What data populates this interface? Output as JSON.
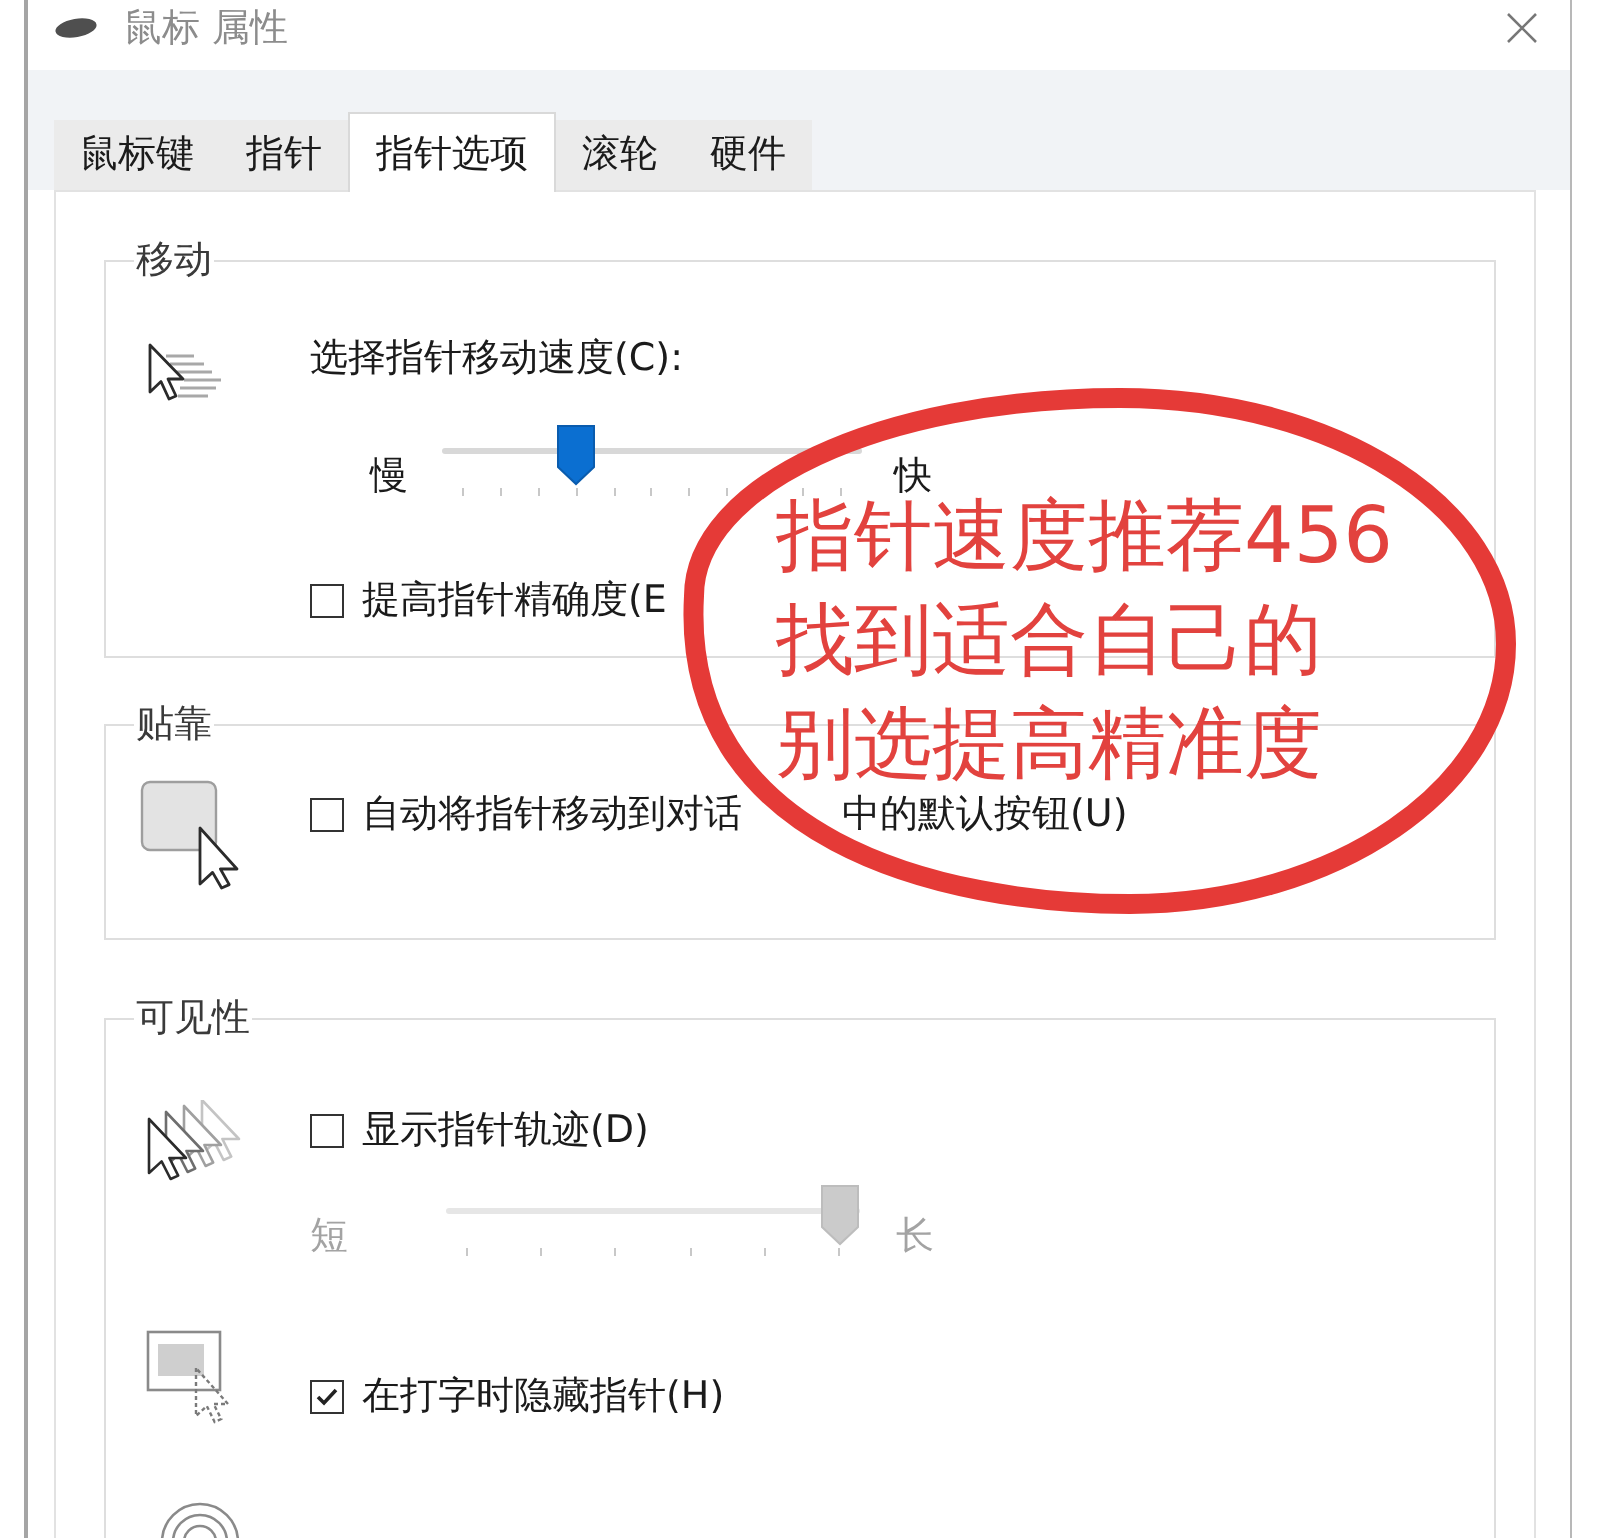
{
  "window": {
    "title": "鼠标 属性"
  },
  "tabs": [
    {
      "label": "鼠标键",
      "selected": false
    },
    {
      "label": "指针",
      "selected": false
    },
    {
      "label": "指针选项",
      "selected": true
    },
    {
      "label": "滚轮",
      "selected": false
    },
    {
      "label": "硬件",
      "selected": false
    }
  ],
  "motion": {
    "title": "移动",
    "speed_label": "选择指针移动速度(C):",
    "speed_slider": {
      "min_label": "慢",
      "max_label": "快",
      "level": 0.3,
      "disabled": false
    },
    "enhance_precision": {
      "label": "提高指针精确度(E",
      "checked": false
    }
  },
  "snap_to": {
    "title": "贴靠",
    "default_button": {
      "label_parts": [
        "自动将指针移动到对话",
        "中的默认按钮(U)"
      ],
      "checked": false
    }
  },
  "visibility": {
    "title": "可见性",
    "pointer_trails": {
      "label": "显示指针轨迹(D)",
      "checked": false
    },
    "trail_slider": {
      "min_label": "短",
      "max_label": "长",
      "level": 1,
      "disabled": true
    },
    "hide_while_typing": {
      "label": "在打字时隐藏指针(H)",
      "checked": true
    }
  },
  "annotation": {
    "lines": [
      "指针速度推荐456",
      "找到适合自己的",
      "别选提高精准度"
    ]
  }
}
